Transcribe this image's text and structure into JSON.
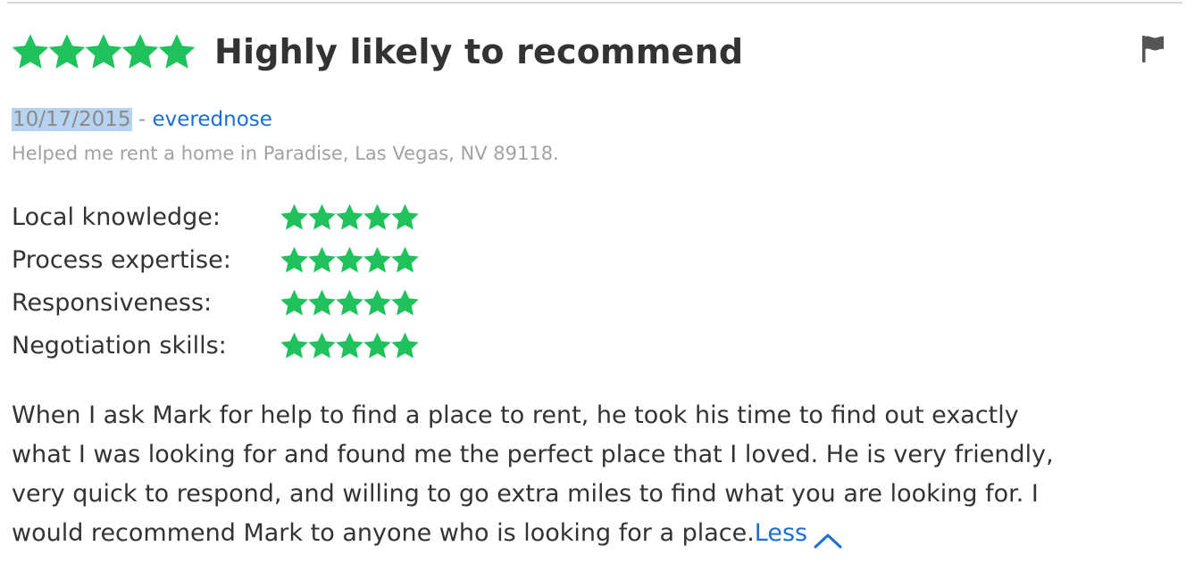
{
  "review": {
    "overall_rating": 5,
    "rating_max": 5,
    "headline": "Highly likely to recommend",
    "date": "10/17/2015",
    "separator": "-",
    "reviewer": "everednose",
    "helped_text": "Helped me rent a home in Paradise, Las Vegas, NV 89118.",
    "flag_icon": "flag-icon",
    "star_color": "#1fc25b",
    "link_color": "#1a6fd6",
    "sub_ratings": [
      {
        "label": "Local knowledge:",
        "rating": 5
      },
      {
        "label": "Process expertise:",
        "rating": 5
      },
      {
        "label": "Responsiveness:",
        "rating": 5
      },
      {
        "label": "Negotiation skills:",
        "rating": 5
      }
    ],
    "body_lines": [
      "When I ask Mark for help to find a place to rent, he took his time to find out exactly",
      "what I was looking for and found me the perfect place that I loved. He is very friendly,",
      "very quick to respond, and willing to go extra miles to find what you are looking for. I",
      "would recommend Mark to anyone who is looking for a place."
    ],
    "less_label": "Less",
    "less_icon": "chevron-up-icon"
  }
}
